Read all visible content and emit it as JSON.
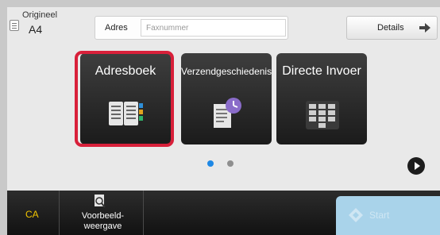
{
  "header": {
    "original_label": "Origineel",
    "original_value": "A4",
    "address_label": "Adres",
    "address_placeholder": "Faxnummer",
    "details_label": "Details"
  },
  "tiles": [
    {
      "label": "Adresboek",
      "icon": "address-book-icon",
      "selected": true
    },
    {
      "label": "Verzendgeschiedenis",
      "icon": "send-history-icon",
      "selected": false
    },
    {
      "label": "Directe Invoer",
      "icon": "keypad-icon",
      "selected": false
    }
  ],
  "pager": {
    "current_page": 1,
    "page_count": 2
  },
  "bottom_bar": {
    "ca_label": "CA",
    "preview_label": "Voorbeeld-\nweergave",
    "start_label": "Start",
    "start_enabled": false
  },
  "colors": {
    "highlight": "#d8203a",
    "ca_text": "#f2c500",
    "active_dot": "#1e88e5",
    "start_button": "#a9d3ea"
  }
}
